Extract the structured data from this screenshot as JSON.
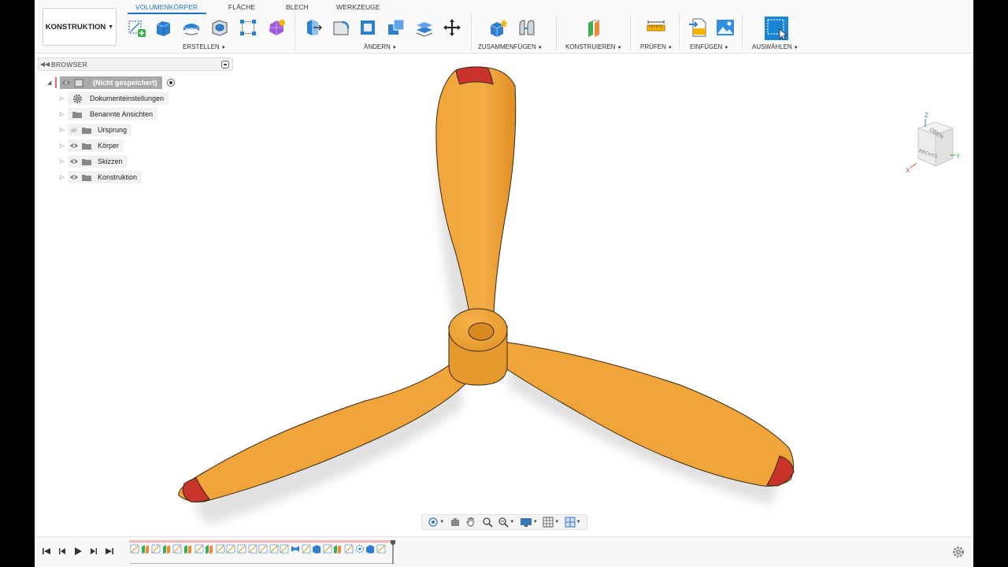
{
  "workspace": {
    "label": "KONSTRUKTION"
  },
  "tabs": [
    {
      "label": "VOLUMENKÖRPER",
      "active": true
    },
    {
      "label": "FLÄCHE",
      "active": false
    },
    {
      "label": "BLECH",
      "active": false
    },
    {
      "label": "WERKZEUGE",
      "active": false
    }
  ],
  "groups": {
    "erstellen": "ERSTELLEN",
    "aendern": "ÄNDERN",
    "zusammenfuegen": "ZUSAMMENFÜGEN",
    "konstruieren": "KONSTRUIEREN",
    "pruefen": "PRÜFEN",
    "einfuegen": "EINFÜGEN",
    "auswaehlen": "AUSWÄHLEN"
  },
  "browser": {
    "title": "BROWSER",
    "root": {
      "label": "(Nicht gespeichert)"
    },
    "items": [
      {
        "label": "Dokumenteinstellungen",
        "icon": "gear-icon"
      },
      {
        "label": "Benannte Ansichten",
        "icon": "folder-icon"
      },
      {
        "label": "Ursprung",
        "icon": "folder-icon",
        "visible": false
      },
      {
        "label": "Körper",
        "icon": "folder-icon",
        "visible": true
      },
      {
        "label": "Skizzen",
        "icon": "folder-icon",
        "visible": true
      },
      {
        "label": "Konstruktion",
        "icon": "folder-icon",
        "visible": true
      }
    ]
  },
  "viewcube": {
    "top_label": "OBEN",
    "front_label": "RECHTS",
    "axis_x": "X",
    "axis_y": "Y",
    "axis_z": "Z"
  },
  "colors": {
    "accent": "#1a73c8",
    "propeller": "#f0a43a",
    "propeller_tip": "#c8342a"
  }
}
